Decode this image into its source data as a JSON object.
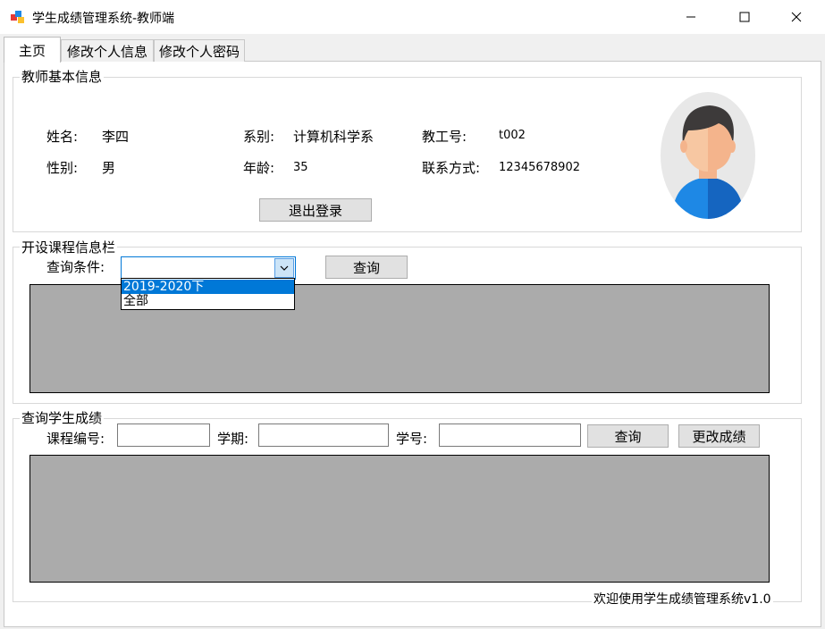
{
  "window": {
    "title": "学生成绩管理系统-教师端",
    "icons": {
      "app": "app-icon",
      "minimize": "minimize-icon",
      "maximize": "maximize-icon",
      "close": "close-icon"
    }
  },
  "tabs": [
    {
      "label": "主页",
      "active": true
    },
    {
      "label": "修改个人信息",
      "active": false
    },
    {
      "label": "修改个人密码",
      "active": false
    }
  ],
  "teacher_info": {
    "group_title": "教师基本信息",
    "name_label": "姓名:",
    "name_value": "李四",
    "department_label": "系别:",
    "department_value": "计算机科学系",
    "staff_id_label": "教工号:",
    "staff_id_value": "t002",
    "gender_label": "性别:",
    "gender_value": "男",
    "age_label": "年龄:",
    "age_value": "35",
    "contact_label": "联系方式:",
    "contact_value": "12345678902",
    "logout_button": "退出登录",
    "avatar_icon": "user-avatar-icon"
  },
  "course_info": {
    "group_title": "开设课程信息栏",
    "query_condition_label": "查询条件:",
    "query_condition_value": "",
    "dropdown_options": [
      "2019-2020下",
      "全部"
    ],
    "selected_option": "2019-2020下",
    "query_button": "查询"
  },
  "score_query": {
    "group_title": "查询学生成绩",
    "course_id_label": "课程编号:",
    "course_id_value": "",
    "term_label": "学期:",
    "term_value": "",
    "student_id_label": "学号:",
    "student_id_value": "",
    "query_button": "查询",
    "modify_button": "更改成绩"
  },
  "footer": {
    "welcome_text": "欢迎使用学生成绩管理系统v1.0"
  },
  "colors": {
    "accent": "#0078d7",
    "grid_background": "#ababab",
    "window_background": "#f0f0f0"
  }
}
